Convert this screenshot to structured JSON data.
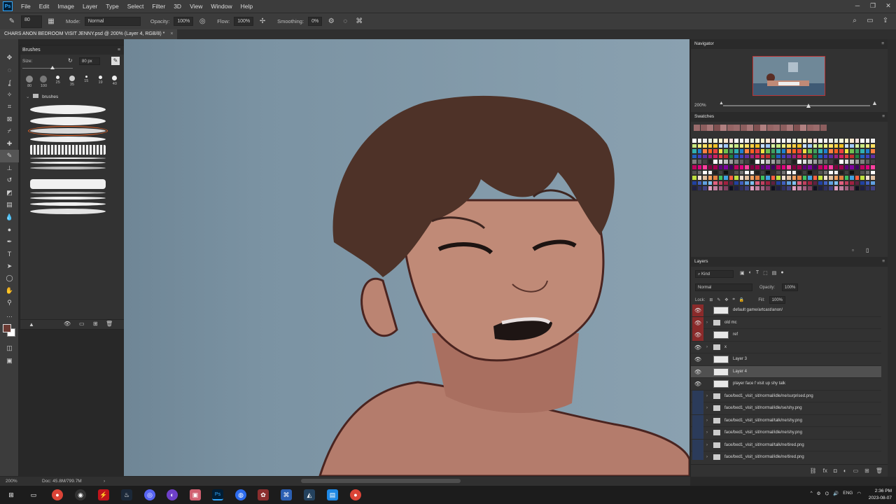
{
  "menubar": {
    "items": [
      "File",
      "Edit",
      "Image",
      "Layer",
      "Type",
      "Select",
      "Filter",
      "3D",
      "View",
      "Window",
      "Help"
    ]
  },
  "options": {
    "brush_size_preview": "80",
    "mode_label": "Mode:",
    "mode_value": "Normal",
    "opacity_label": "Opacity:",
    "opacity_value": "100%",
    "flow_label": "Flow:",
    "flow_value": "100%",
    "smoothing_label": "Smoothing:",
    "smoothing_value": "0%"
  },
  "document": {
    "tab_title": "CHARS ANON BEDROOM VISIT JENNY.psd @ 200% (Layer 4, RGB/8) *"
  },
  "brushes": {
    "title": "Brushes",
    "size_label": "Size:",
    "size_value": "80 px",
    "presets": [
      "80",
      "100",
      "25",
      "35",
      "15",
      "19",
      "40"
    ],
    "folder_name": "brushes"
  },
  "status": {
    "zoom": "200%",
    "doc_size": "Doc: 45.8M/799.7M"
  },
  "navigator": {
    "title": "Navigator",
    "zoom": "200%"
  },
  "swatches": {
    "title": "Swatches"
  },
  "layers": {
    "title": "Layers",
    "kind_label": "Kind",
    "blend_mode": "Normal",
    "opacity_label": "Opacity:",
    "opacity_value": "100%",
    "lock_label": "Lock:",
    "fill_label": "Fill:",
    "fill_value": "100%",
    "rows": [
      {
        "name": "default game/artcast/anon/",
        "vis": "red",
        "kind": "layer"
      },
      {
        "name": "old mc",
        "vis": "red",
        "kind": "folder"
      },
      {
        "name": "ref",
        "vis": "red",
        "kind": "layer"
      },
      {
        "name": "x",
        "vis": "eye",
        "kind": "folder"
      },
      {
        "name": "Layer 3",
        "vis": "eye",
        "kind": "layer"
      },
      {
        "name": "Layer 4",
        "vis": "eye",
        "kind": "layer",
        "selected": true
      },
      {
        "name": "player face f visit up shy talk",
        "vis": "eye",
        "kind": "layer"
      },
      {
        "name": "face/bed1_visit_sit/normal/idle/ne/surprised.png",
        "vis": "blue",
        "kind": "folder"
      },
      {
        "name": "face/bed1_visit_sit/normal/idle/se/shy.png",
        "vis": "blue",
        "kind": "folder"
      },
      {
        "name": "face/bed1_visit_sit/normal/talk/ne/shy.png",
        "vis": "blue",
        "kind": "folder"
      },
      {
        "name": "face/bed1_visit_sit/normal/idle/ne/shy.png",
        "vis": "blue",
        "kind": "folder"
      },
      {
        "name": "face/bed1_visit_sit/normal/talk/ne/tired.png",
        "vis": "blue",
        "kind": "folder"
      },
      {
        "name": "face/bed1_visit_sit/normal/idle/ne/tired.png",
        "vis": "blue",
        "kind": "folder"
      }
    ]
  },
  "taskbar": {
    "lang": "ENG",
    "time": "2:36 PM",
    "date": "2023-08-07"
  }
}
